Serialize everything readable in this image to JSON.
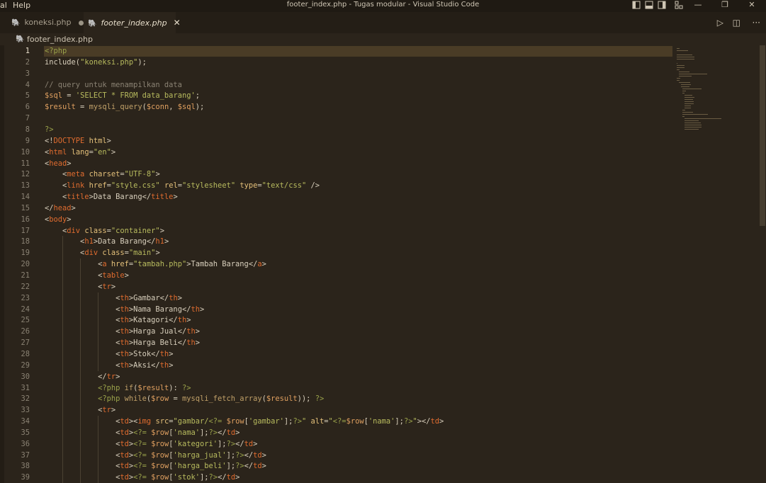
{
  "menu": {
    "left_fragment": "al",
    "help": "Help"
  },
  "window_title": "footer_index.php - Tugas modular - Visual Studio Code",
  "window_controls": {
    "minimize": "—",
    "maximize": "❐",
    "close": "✕"
  },
  "tabs": [
    {
      "label": "koneksi.php",
      "icon": "php-icon",
      "modified": true,
      "active": false
    },
    {
      "label": "footer_index.php",
      "icon": "php-icon",
      "modified": false,
      "active": true,
      "close": "✕"
    }
  ],
  "tab_actions": {
    "run": "▷",
    "split": "◫",
    "more": "···"
  },
  "breadcrumb": {
    "file": "footer_index.php"
  },
  "editor": {
    "current_line": 1,
    "lines": [
      {
        "n": "1",
        "tokens": [
          [
            "p",
            "<?php"
          ]
        ]
      },
      {
        "n": "2",
        "tokens": [
          [
            "t",
            "include"
          ],
          [
            "t",
            "("
          ],
          [
            "s",
            "\"koneksi.php\""
          ],
          [
            "t",
            ");"
          ]
        ]
      },
      {
        "n": "3",
        "tokens": []
      },
      {
        "n": "4",
        "tokens": [
          [
            "c",
            "// query untuk menampilkan data"
          ]
        ]
      },
      {
        "n": "5",
        "tokens": [
          [
            "v",
            "$sql"
          ],
          [
            "t",
            " = "
          ],
          [
            "s",
            "'SELECT * FROM data_barang'"
          ],
          [
            "t",
            ";"
          ]
        ]
      },
      {
        "n": "6",
        "tokens": [
          [
            "v",
            "$result"
          ],
          [
            "t",
            " = "
          ],
          [
            "f",
            "mysqli_query"
          ],
          [
            "t",
            "("
          ],
          [
            "v",
            "$conn"
          ],
          [
            "t",
            ", "
          ],
          [
            "v",
            "$sql"
          ],
          [
            "t",
            ");"
          ]
        ]
      },
      {
        "n": "7",
        "tokens": []
      },
      {
        "n": "8",
        "tokens": [
          [
            "p",
            "?>"
          ]
        ]
      },
      {
        "n": "9",
        "tokens": [
          [
            "t",
            "<!"
          ],
          [
            "k",
            "DOCTYPE"
          ],
          [
            "t",
            " "
          ],
          [
            "a",
            "html"
          ],
          [
            "t",
            ">"
          ]
        ]
      },
      {
        "n": "10",
        "tokens": [
          [
            "t",
            "<"
          ],
          [
            "k",
            "html"
          ],
          [
            "t",
            " "
          ],
          [
            "a",
            "lang"
          ],
          [
            "t",
            "="
          ],
          [
            "s",
            "\"en\""
          ],
          [
            "t",
            ">"
          ]
        ]
      },
      {
        "n": "11",
        "tokens": [
          [
            "t",
            "<"
          ],
          [
            "k",
            "head"
          ],
          [
            "t",
            ">"
          ]
        ]
      },
      {
        "n": "12",
        "tokens": [
          [
            "t",
            "    <"
          ],
          [
            "k",
            "meta"
          ],
          [
            "t",
            " "
          ],
          [
            "a",
            "charset"
          ],
          [
            "t",
            "="
          ],
          [
            "s",
            "\"UTF-8\""
          ],
          [
            "t",
            ">"
          ]
        ]
      },
      {
        "n": "13",
        "tokens": [
          [
            "t",
            "    <"
          ],
          [
            "k",
            "link"
          ],
          [
            "t",
            " "
          ],
          [
            "a",
            "href"
          ],
          [
            "t",
            "="
          ],
          [
            "s",
            "\"style.css\""
          ],
          [
            "t",
            " "
          ],
          [
            "a",
            "rel"
          ],
          [
            "t",
            "="
          ],
          [
            "s",
            "\"stylesheet\""
          ],
          [
            "t",
            " "
          ],
          [
            "a",
            "type"
          ],
          [
            "t",
            "="
          ],
          [
            "s",
            "\"text/css\""
          ],
          [
            "t",
            " />"
          ]
        ]
      },
      {
        "n": "14",
        "tokens": [
          [
            "t",
            "    <"
          ],
          [
            "k",
            "title"
          ],
          [
            "t",
            ">Data Barang</"
          ],
          [
            "k",
            "title"
          ],
          [
            "t",
            ">"
          ]
        ]
      },
      {
        "n": "15",
        "tokens": [
          [
            "t",
            "</"
          ],
          [
            "k",
            "head"
          ],
          [
            "t",
            ">"
          ]
        ]
      },
      {
        "n": "16",
        "tokens": [
          [
            "t",
            "<"
          ],
          [
            "k",
            "body"
          ],
          [
            "t",
            ">"
          ]
        ]
      },
      {
        "n": "17",
        "tokens": [
          [
            "t",
            "    <"
          ],
          [
            "k",
            "div"
          ],
          [
            "t",
            " "
          ],
          [
            "a",
            "class"
          ],
          [
            "t",
            "="
          ],
          [
            "s",
            "\"container\""
          ],
          [
            "t",
            ">"
          ]
        ]
      },
      {
        "n": "18",
        "tokens": [
          [
            "t",
            "        <"
          ],
          [
            "k",
            "h1"
          ],
          [
            "t",
            ">Data Barang</"
          ],
          [
            "k",
            "h1"
          ],
          [
            "t",
            ">"
          ]
        ]
      },
      {
        "n": "19",
        "tokens": [
          [
            "t",
            "        <"
          ],
          [
            "k",
            "div"
          ],
          [
            "t",
            " "
          ],
          [
            "a",
            "class"
          ],
          [
            "t",
            "="
          ],
          [
            "s",
            "\"main\""
          ],
          [
            "t",
            ">"
          ]
        ]
      },
      {
        "n": "20",
        "tokens": [
          [
            "t",
            "            <"
          ],
          [
            "k",
            "a"
          ],
          [
            "t",
            " "
          ],
          [
            "a",
            "href"
          ],
          [
            "t",
            "="
          ],
          [
            "s",
            "\"tambah.php\""
          ],
          [
            "t",
            ">Tambah Barang</"
          ],
          [
            "k",
            "a"
          ],
          [
            "t",
            ">"
          ]
        ]
      },
      {
        "n": "21",
        "tokens": [
          [
            "t",
            "            <"
          ],
          [
            "k",
            "table"
          ],
          [
            "t",
            ">"
          ]
        ]
      },
      {
        "n": "22",
        "tokens": [
          [
            "t",
            "            <"
          ],
          [
            "k",
            "tr"
          ],
          [
            "t",
            ">"
          ]
        ]
      },
      {
        "n": "23",
        "tokens": [
          [
            "t",
            "                <"
          ],
          [
            "k",
            "th"
          ],
          [
            "t",
            ">Gambar</"
          ],
          [
            "k",
            "th"
          ],
          [
            "t",
            ">"
          ]
        ]
      },
      {
        "n": "24",
        "tokens": [
          [
            "t",
            "                <"
          ],
          [
            "k",
            "th"
          ],
          [
            "t",
            ">Nama Barang</"
          ],
          [
            "k",
            "th"
          ],
          [
            "t",
            ">"
          ]
        ]
      },
      {
        "n": "25",
        "tokens": [
          [
            "t",
            "                <"
          ],
          [
            "k",
            "th"
          ],
          [
            "t",
            ">Katagori</"
          ],
          [
            "k",
            "th"
          ],
          [
            "t",
            ">"
          ]
        ]
      },
      {
        "n": "26",
        "tokens": [
          [
            "t",
            "                <"
          ],
          [
            "k",
            "th"
          ],
          [
            "t",
            ">Harga Jual</"
          ],
          [
            "k",
            "th"
          ],
          [
            "t",
            ">"
          ]
        ]
      },
      {
        "n": "27",
        "tokens": [
          [
            "t",
            "                <"
          ],
          [
            "k",
            "th"
          ],
          [
            "t",
            ">Harga Beli</"
          ],
          [
            "k",
            "th"
          ],
          [
            "t",
            ">"
          ]
        ]
      },
      {
        "n": "28",
        "tokens": [
          [
            "t",
            "                <"
          ],
          [
            "k",
            "th"
          ],
          [
            "t",
            ">Stok</"
          ],
          [
            "k",
            "th"
          ],
          [
            "t",
            ">"
          ]
        ]
      },
      {
        "n": "29",
        "tokens": [
          [
            "t",
            "                <"
          ],
          [
            "k",
            "th"
          ],
          [
            "t",
            ">Aksi</"
          ],
          [
            "k",
            "th"
          ],
          [
            "t",
            ">"
          ]
        ]
      },
      {
        "n": "30",
        "tokens": [
          [
            "t",
            "            </"
          ],
          [
            "k",
            "tr"
          ],
          [
            "t",
            ">"
          ]
        ]
      },
      {
        "n": "31",
        "tokens": [
          [
            "t",
            "            "
          ],
          [
            "p",
            "<?php"
          ],
          [
            "t",
            " "
          ],
          [
            "f",
            "if"
          ],
          [
            "t",
            "("
          ],
          [
            "v",
            "$result"
          ],
          [
            "t",
            "): "
          ],
          [
            "p",
            "?>"
          ]
        ]
      },
      {
        "n": "32",
        "tokens": [
          [
            "t",
            "            "
          ],
          [
            "p",
            "<?php"
          ],
          [
            "t",
            " "
          ],
          [
            "f",
            "while"
          ],
          [
            "t",
            "("
          ],
          [
            "v",
            "$row"
          ],
          [
            "t",
            " = "
          ],
          [
            "f",
            "mysqli_fetch_array"
          ],
          [
            "t",
            "("
          ],
          [
            "v",
            "$result"
          ],
          [
            "t",
            "));"
          ],
          [
            "t",
            " "
          ],
          [
            "p",
            "?>"
          ]
        ]
      },
      {
        "n": "33",
        "tokens": [
          [
            "t",
            "            <"
          ],
          [
            "k",
            "tr"
          ],
          [
            "t",
            ">"
          ]
        ]
      },
      {
        "n": "34",
        "tokens": [
          [
            "t",
            "                <"
          ],
          [
            "k",
            "td"
          ],
          [
            "t",
            "><"
          ],
          [
            "k",
            "img"
          ],
          [
            "t",
            " "
          ],
          [
            "a",
            "src"
          ],
          [
            "t",
            "="
          ],
          [
            "s",
            "\"gambar/"
          ],
          [
            "p",
            "<?="
          ],
          [
            "t",
            " "
          ],
          [
            "v",
            "$row"
          ],
          [
            "t",
            "["
          ],
          [
            "s",
            "'gambar'"
          ],
          [
            "t",
            "];"
          ],
          [
            "p",
            "?>"
          ],
          [
            "s",
            "\""
          ],
          [
            "t",
            " "
          ],
          [
            "a",
            "alt"
          ],
          [
            "t",
            "="
          ],
          [
            "s",
            "\""
          ],
          [
            "p",
            "<?="
          ],
          [
            "v",
            "$row"
          ],
          [
            "t",
            "["
          ],
          [
            "s",
            "'nama'"
          ],
          [
            "t",
            "];"
          ],
          [
            "p",
            "?>"
          ],
          [
            "s",
            "\""
          ],
          [
            "t",
            "></"
          ],
          [
            "k",
            "td"
          ],
          [
            "t",
            ">"
          ]
        ]
      },
      {
        "n": "35",
        "tokens": [
          [
            "t",
            "                <"
          ],
          [
            "k",
            "td"
          ],
          [
            "t",
            ">"
          ],
          [
            "p",
            "<?="
          ],
          [
            "t",
            " "
          ],
          [
            "v",
            "$row"
          ],
          [
            "t",
            "["
          ],
          [
            "s",
            "'nama'"
          ],
          [
            "t",
            "];"
          ],
          [
            "p",
            "?>"
          ],
          [
            "t",
            "</"
          ],
          [
            "k",
            "td"
          ],
          [
            "t",
            ">"
          ]
        ]
      },
      {
        "n": "36",
        "tokens": [
          [
            "t",
            "                <"
          ],
          [
            "k",
            "td"
          ],
          [
            "t",
            ">"
          ],
          [
            "p",
            "<?="
          ],
          [
            "t",
            " "
          ],
          [
            "v",
            "$row"
          ],
          [
            "t",
            "["
          ],
          [
            "s",
            "'kategori'"
          ],
          [
            "t",
            "];"
          ],
          [
            "p",
            "?>"
          ],
          [
            "t",
            "</"
          ],
          [
            "k",
            "td"
          ],
          [
            "t",
            ">"
          ]
        ]
      },
      {
        "n": "37",
        "tokens": [
          [
            "t",
            "                <"
          ],
          [
            "k",
            "td"
          ],
          [
            "t",
            ">"
          ],
          [
            "p",
            "<?="
          ],
          [
            "t",
            " "
          ],
          [
            "v",
            "$row"
          ],
          [
            "t",
            "["
          ],
          [
            "s",
            "'harga_jual'"
          ],
          [
            "t",
            "];"
          ],
          [
            "p",
            "?>"
          ],
          [
            "t",
            "</"
          ],
          [
            "k",
            "td"
          ],
          [
            "t",
            ">"
          ]
        ]
      },
      {
        "n": "38",
        "tokens": [
          [
            "t",
            "                <"
          ],
          [
            "k",
            "td"
          ],
          [
            "t",
            ">"
          ],
          [
            "p",
            "<?="
          ],
          [
            "t",
            " "
          ],
          [
            "v",
            "$row"
          ],
          [
            "t",
            "["
          ],
          [
            "s",
            "'harga_beli'"
          ],
          [
            "t",
            "];"
          ],
          [
            "p",
            "?>"
          ],
          [
            "t",
            "</"
          ],
          [
            "k",
            "td"
          ],
          [
            "t",
            ">"
          ]
        ]
      },
      {
        "n": "39",
        "tokens": [
          [
            "t",
            "                <"
          ],
          [
            "k",
            "td"
          ],
          [
            "t",
            ">"
          ],
          [
            "p",
            "<?="
          ],
          [
            "t",
            " "
          ],
          [
            "v",
            "$row"
          ],
          [
            "t",
            "["
          ],
          [
            "s",
            "'stok'"
          ],
          [
            "t",
            "];"
          ],
          [
            "p",
            "?>"
          ],
          [
            "t",
            "</"
          ],
          [
            "k",
            "td"
          ],
          [
            "t",
            ">"
          ]
        ]
      }
    ]
  }
}
